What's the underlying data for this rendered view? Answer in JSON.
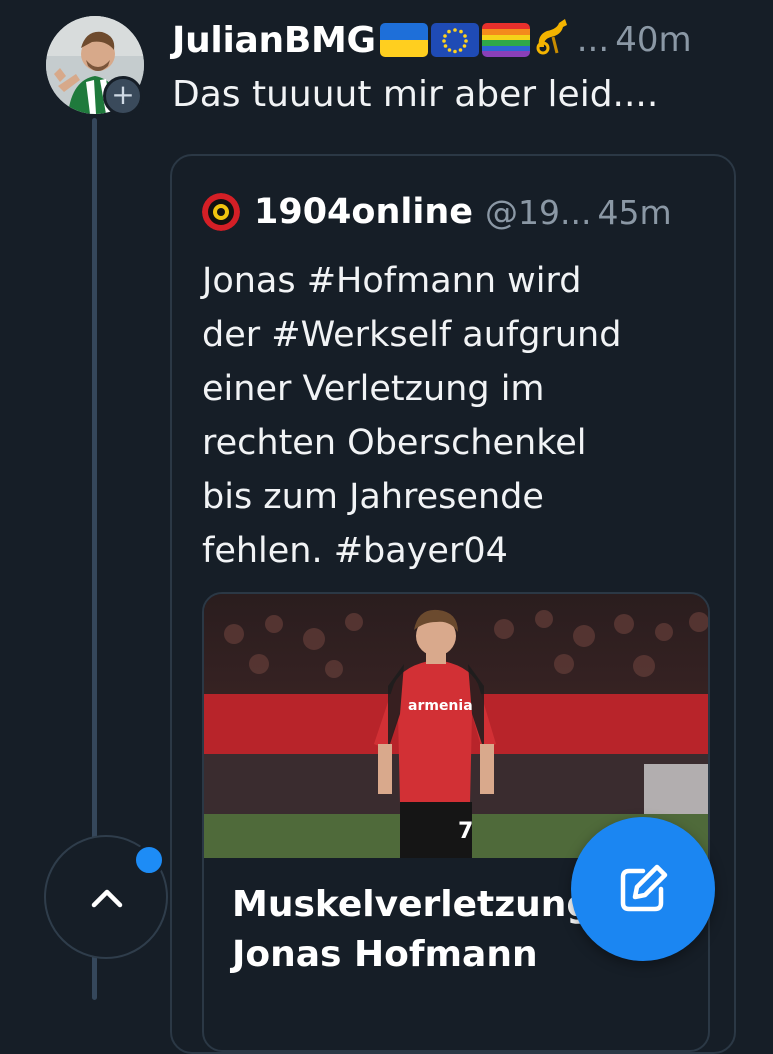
{
  "post": {
    "author": "JulianBMG",
    "emoji": [
      "ukraine-flag",
      "eu-flag",
      "rainbow-flag",
      "postal-horn"
    ],
    "handle_truncated": "...",
    "time": "40m",
    "text": "Das tuuuut mir aber leid....",
    "follow_icon": "+"
  },
  "quote": {
    "author": "1904online",
    "handle": "@19...",
    "time": "45m",
    "text_lines": [
      "Jonas #Hofmann wird",
      "der #Werkself aufgrund",
      "einer Verletzung im",
      "rechten Oberschenkel",
      "bis zum Jahresende",
      "fehlen. #bayer04"
    ],
    "link_card": {
      "title_lines": [
        "Muskelverletzung",
        "Jonas Hofmann"
      ],
      "jersey_text": "armenia",
      "jersey_number": "7"
    }
  },
  "controls": {
    "scroll_top_icon": "chevron-up-icon",
    "compose_icon": "compose-icon"
  },
  "colors": {
    "background": "#161e27",
    "accent": "#1b86f2",
    "muted_text": "#8b98a5"
  }
}
